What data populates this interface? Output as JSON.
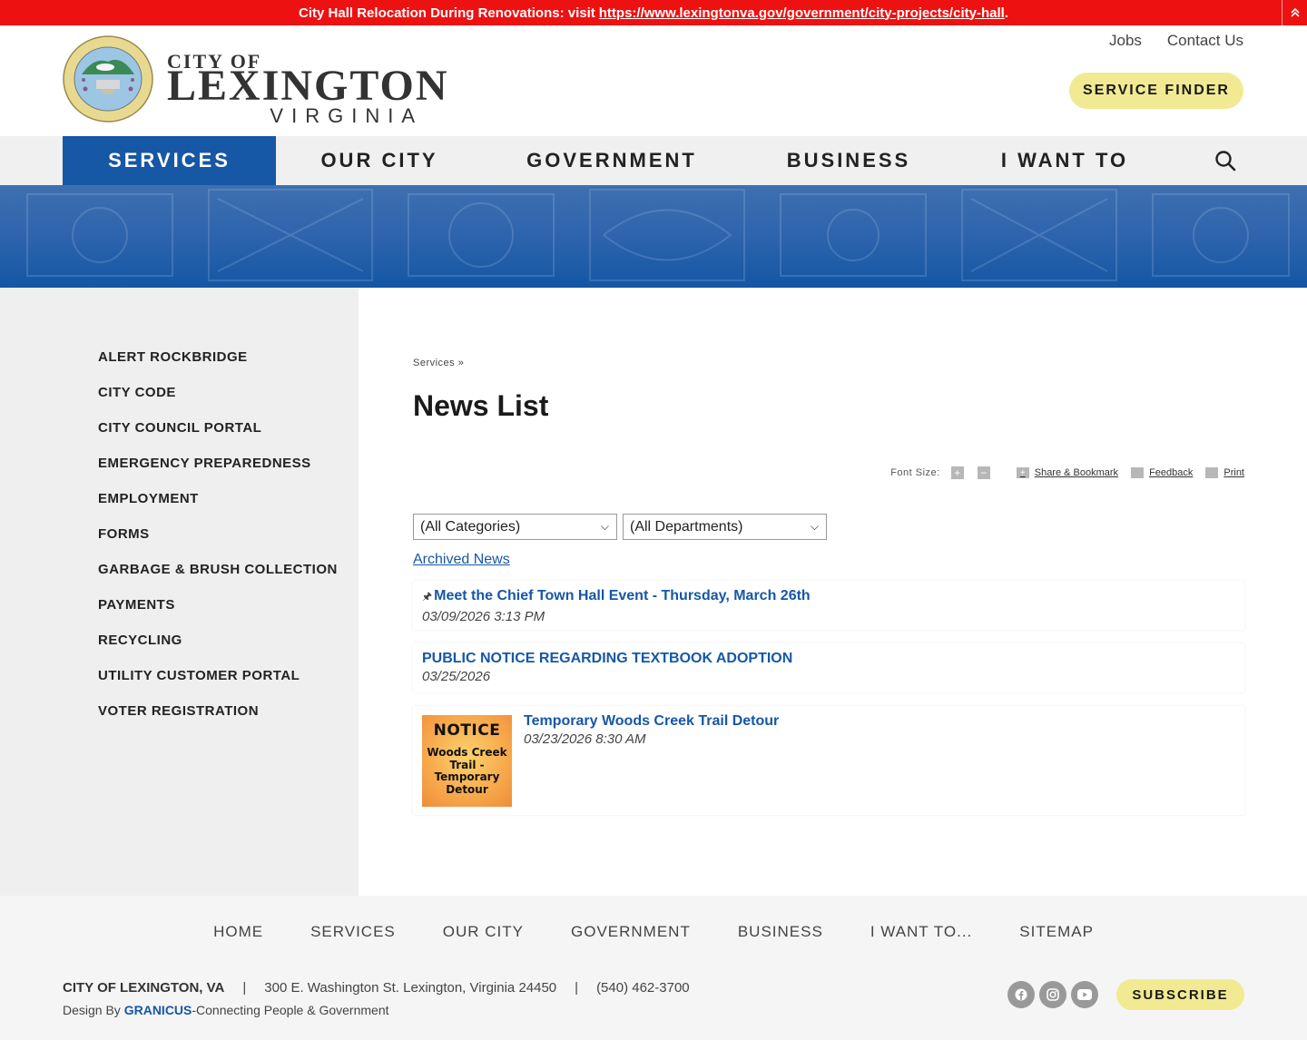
{
  "alert": {
    "text": "City Hall Relocation During Renovations: visit",
    "link": "https://www.lexingtonva.gov/government/city-projects/city-hall",
    "trailing": ".",
    "collapse_icon": "double-chevron-up-icon"
  },
  "header": {
    "logo": {
      "city_of": "CITY OF",
      "name": "LEXINGTON",
      "state": "VIRGINIA"
    },
    "utility_links": [
      "Jobs",
      "Contact Us"
    ],
    "service_finder": "SERVICE FINDER"
  },
  "nav": {
    "items": [
      "SERVICES",
      "OUR CITY",
      "GOVERNMENT",
      "BUSINESS",
      "I WANT TO"
    ],
    "active": "SERVICES",
    "search_icon": "search-icon"
  },
  "sidebar": {
    "items": [
      "ALERT ROCKBRIDGE",
      "CITY CODE",
      "CITY COUNCIL PORTAL",
      "EMERGENCY PREPAREDNESS",
      "EMPLOYMENT",
      "FORMS",
      "GARBAGE & BRUSH COLLECTION",
      "PAYMENTS",
      "RECYCLING",
      "UTILITY CUSTOMER PORTAL",
      "VOTER REGISTRATION"
    ]
  },
  "content": {
    "breadcrumb": "Services »",
    "title": "News List",
    "tools": {
      "font_size_label": "Font Size:",
      "increase": "+",
      "decrease": "−",
      "share": "Share & Bookmark",
      "feedback": "Feedback",
      "print": "Print"
    },
    "filters": {
      "category": "(All Categories)",
      "department": "(All Departments)"
    },
    "archived_link": "Archived News",
    "news": [
      {
        "title": "Meet the Chief Town Hall Event - Thursday, March 26th",
        "date": "03/09/2026 3:13 PM",
        "pinned": true
      },
      {
        "title": "PUBLIC NOTICE REGARDING TEXTBOOK ADOPTION",
        "date": "03/25/2026",
        "pinned": false
      },
      {
        "title": "Temporary Woods Creek Trail Detour",
        "date": "03/23/2026 8:30 AM",
        "pinned": false,
        "thumbnail": {
          "heading": "NOTICE",
          "l1": "Woods Creek",
          "l2": "Trail -",
          "l3": "Temporary",
          "l4": "Detour"
        }
      }
    ]
  },
  "footer": {
    "nav": [
      "HOME",
      "SERVICES",
      "OUR CITY",
      "GOVERNMENT",
      "BUSINESS",
      "I WANT TO...",
      "SITEMAP"
    ],
    "org": "CITY OF LEXINGTON, VA",
    "address": "300 E. Washington St. Lexington, Virginia 24450",
    "phone": "(540) 462-3700",
    "design_by": "Design By",
    "granicus": "GRANICUS",
    "tagline": "-Connecting People & Government",
    "socials": [
      "facebook-icon",
      "instagram-icon",
      "youtube-icon"
    ],
    "subscribe": "SUBSCRIBE"
  },
  "colors": {
    "alert": "#ee1111",
    "brand_blue": "#1657a6",
    "accent_yellow": "#f1ea93"
  }
}
